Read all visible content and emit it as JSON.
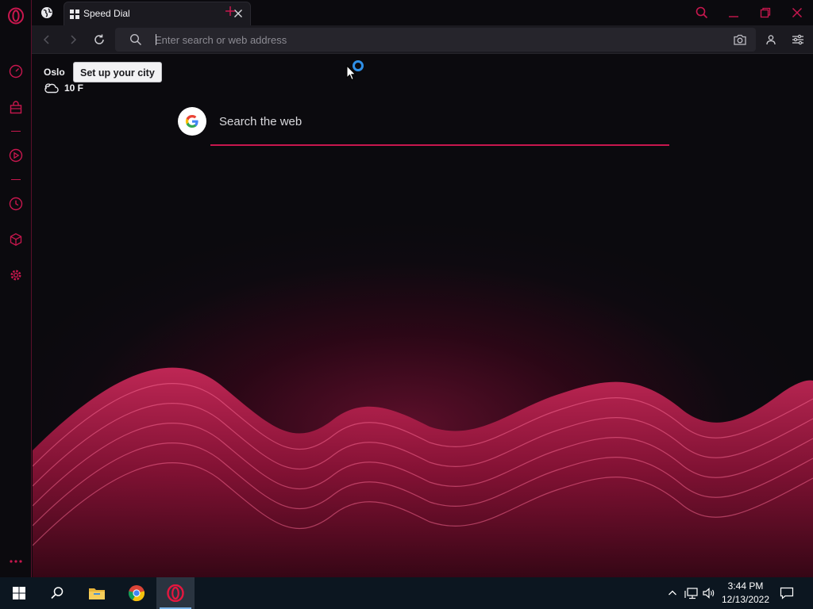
{
  "browser": {
    "tab": {
      "title": "Speed Dial"
    },
    "address_bar": {
      "placeholder": "Enter search or web address",
      "value": ""
    }
  },
  "sidebar": {
    "items": [
      {
        "icon": "opera-logo-icon"
      },
      {
        "icon": "speedometer-icon"
      },
      {
        "icon": "bag-icon"
      },
      {
        "icon": "player-icon"
      },
      {
        "icon": "history-icon"
      },
      {
        "icon": "cube-icon"
      },
      {
        "icon": "settings-icon"
      },
      {
        "icon": "more-icon"
      }
    ]
  },
  "weather": {
    "city": "Oslo",
    "tooltip": "Set up your city",
    "temperature": "10 F"
  },
  "search": {
    "placeholder": "Search the web",
    "engine_icon": "google-icon"
  },
  "taskbar": {
    "apps": [
      "start-icon",
      "search-icon",
      "file-explorer-icon",
      "chrome-icon",
      "opera-icon"
    ],
    "clock": {
      "time": "3:44 PM",
      "date": "12/13/2022"
    }
  },
  "theme": {
    "accent": "#c8174e",
    "background": "#0b0a0e",
    "toolbar": "#1b1a20"
  }
}
